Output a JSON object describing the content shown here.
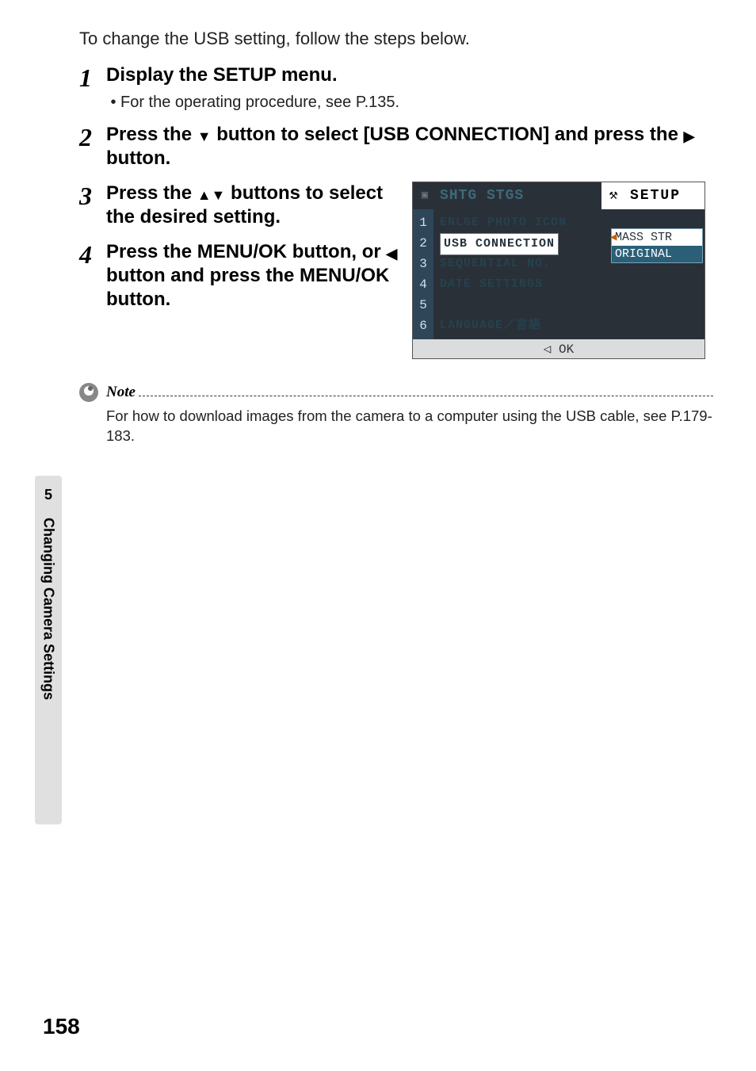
{
  "intro": "To change the USB setting, follow the steps below.",
  "steps": [
    {
      "num": "1",
      "title": "Display the SETUP menu.",
      "sub": "For the operating procedure, see P.135."
    },
    {
      "num": "2",
      "title_pre": "Press the ",
      "title_mid_sym": "▼",
      "title_post": " button to select [USB CONNECTION] and press the ",
      "title_sym2": "▶",
      "title_end": " button."
    },
    {
      "num": "3",
      "title_pre": "Press the ",
      "title_mid_sym": "▲▼",
      "title_post": " buttons to select the desired setting."
    },
    {
      "num": "4",
      "title_pre": "Press the MENU/OK button, or ",
      "title_mid_sym": "◀",
      "title_post": " button and press the MENU/OK button."
    }
  ],
  "lcd": {
    "tab1": "SHTG STGS",
    "tool": "⚒",
    "tab2": "SETUP",
    "nums": [
      "1",
      "2",
      "3",
      "4",
      "5",
      "6"
    ],
    "rows": [
      "ENLGE PHOTO ICON",
      "USB CONNECTION",
      "SEQUENTIAL NO.",
      "DATE SETTINGS",
      "",
      "LANGUAGE／言語"
    ],
    "selected_row_index": 1,
    "options": [
      "MASS STR",
      "ORIGINAL"
    ],
    "selected_option_index": 0,
    "foot_sym": "◁",
    "foot_text": "OK"
  },
  "section": {
    "num": "5",
    "label": "Changing Camera Settings"
  },
  "note": {
    "label": "Note",
    "body": "For how to download images from the camera to a computer using the USB cable, see P.179-183."
  },
  "page_number": "158"
}
